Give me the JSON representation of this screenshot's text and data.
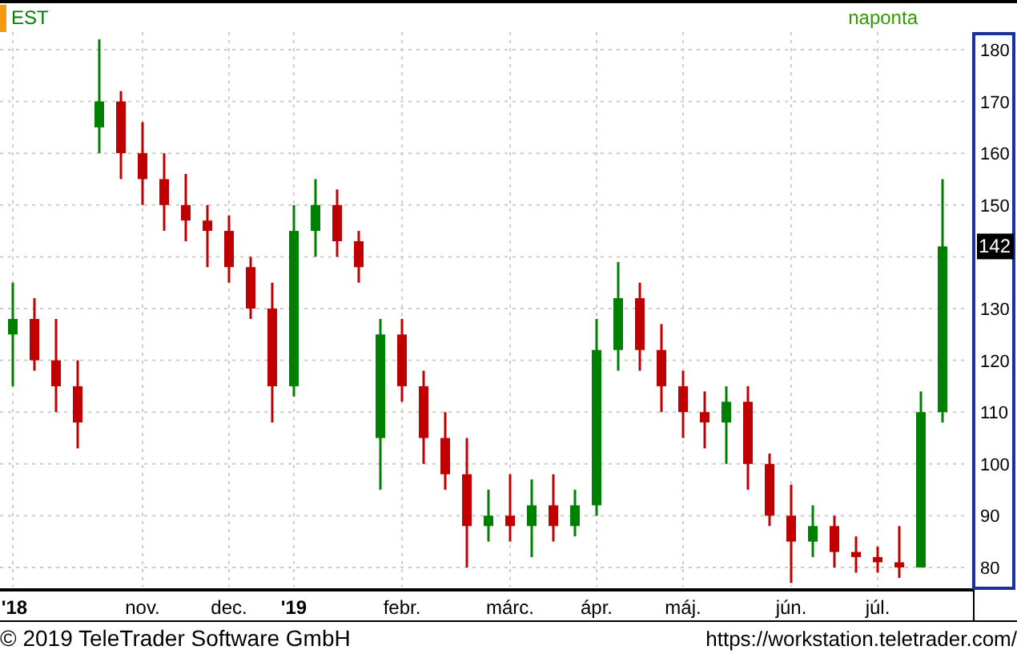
{
  "header": {
    "symbol": "EST",
    "interval": "naponta"
  },
  "chart": {
    "last_price": "142",
    "chart_data": {
      "type": "candlestick",
      "categories": [
        "'18",
        null,
        null,
        null,
        null,
        null,
        "nov.",
        null,
        null,
        null,
        "dec.",
        null,
        null,
        "'19",
        null,
        null,
        null,
        null,
        "febr.",
        null,
        null,
        null,
        null,
        "márc.",
        null,
        null,
        null,
        "ápr.",
        null,
        null,
        null,
        "máj.",
        null,
        null,
        null,
        null,
        "jún.",
        null,
        null,
        null,
        "júl.",
        null,
        null,
        null
      ],
      "ohlc": [
        [
          125,
          135,
          115,
          128
        ],
        [
          128,
          132,
          118,
          120
        ],
        [
          120,
          128,
          110,
          115
        ],
        [
          115,
          120,
          103,
          108
        ],
        [
          165,
          182,
          160,
          170
        ],
        [
          170,
          172,
          155,
          160
        ],
        [
          160,
          166,
          150,
          155
        ],
        [
          155,
          160,
          145,
          150
        ],
        [
          150,
          156,
          143,
          147
        ],
        [
          147,
          150,
          138,
          145
        ],
        [
          145,
          148,
          135,
          138
        ],
        [
          138,
          140,
          128,
          130
        ],
        [
          130,
          135,
          108,
          115
        ],
        [
          115,
          150,
          113,
          145
        ],
        [
          145,
          155,
          140,
          150
        ],
        [
          150,
          153,
          140,
          143
        ],
        [
          143,
          145,
          135,
          138
        ],
        [
          105,
          128,
          95,
          125
        ],
        [
          125,
          128,
          112,
          115
        ],
        [
          115,
          118,
          100,
          105
        ],
        [
          105,
          110,
          95,
          98
        ],
        [
          98,
          105,
          80,
          88
        ],
        [
          88,
          95,
          85,
          90
        ],
        [
          90,
          98,
          85,
          88
        ],
        [
          88,
          97,
          82,
          92
        ],
        [
          92,
          98,
          85,
          88
        ],
        [
          88,
          95,
          86,
          92
        ],
        [
          92,
          128,
          90,
          122
        ],
        [
          122,
          139,
          118,
          132
        ],
        [
          132,
          135,
          118,
          122
        ],
        [
          122,
          127,
          110,
          115
        ],
        [
          115,
          118,
          105,
          110
        ],
        [
          110,
          114,
          103,
          108
        ],
        [
          108,
          115,
          100,
          112
        ],
        [
          112,
          115,
          95,
          100
        ],
        [
          100,
          102,
          88,
          90
        ],
        [
          90,
          96,
          77,
          85
        ],
        [
          85,
          92,
          82,
          88
        ],
        [
          88,
          90,
          80,
          83
        ],
        [
          83,
          86,
          79,
          82
        ],
        [
          82,
          84,
          79,
          81
        ],
        [
          81,
          88,
          78,
          80
        ],
        [
          80,
          114,
          80,
          110
        ],
        [
          110,
          155,
          108,
          142
        ]
      ],
      "ylim": [
        76.6,
        183.4
      ],
      "yticks": [
        80,
        90,
        100,
        110,
        120,
        130,
        150,
        160,
        170,
        180
      ],
      "grid": true
    }
  },
  "footer": {
    "copyright": "© 2019 TeleTrader Software GmbH",
    "url": "https://workstation.teletrader.com/"
  }
}
